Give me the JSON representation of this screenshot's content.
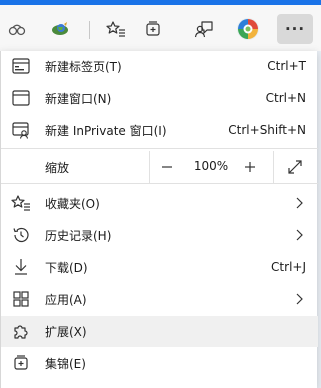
{
  "menu": {
    "new_tab": {
      "label": "新建标签页(T)",
      "shortcut": "Ctrl+T"
    },
    "new_window": {
      "label": "新建窗口(N)",
      "shortcut": "Ctrl+N"
    },
    "new_inprivate": {
      "label": "新建 InPrivate 窗口(I)",
      "shortcut": "Ctrl+Shift+N"
    },
    "zoom": {
      "label": "缩放",
      "minus": "—",
      "value": "100%",
      "plus": "+"
    },
    "favorites": {
      "label": "收藏夹(O)"
    },
    "history": {
      "label": "历史记录(H)"
    },
    "downloads": {
      "label": "下载(D)",
      "shortcut": "Ctrl+J"
    },
    "apps": {
      "label": "应用(A)"
    },
    "extensions": {
      "label": "扩展(X)"
    },
    "collections": {
      "label": "集锦(E)"
    }
  },
  "toolbar": {
    "more_label": "···"
  },
  "colors": {
    "accent": "#1a73e8",
    "toolbar_bg": "#f7f7f7",
    "menu_bg": "#ffffff",
    "hover_bg": "#f0f0f0"
  }
}
